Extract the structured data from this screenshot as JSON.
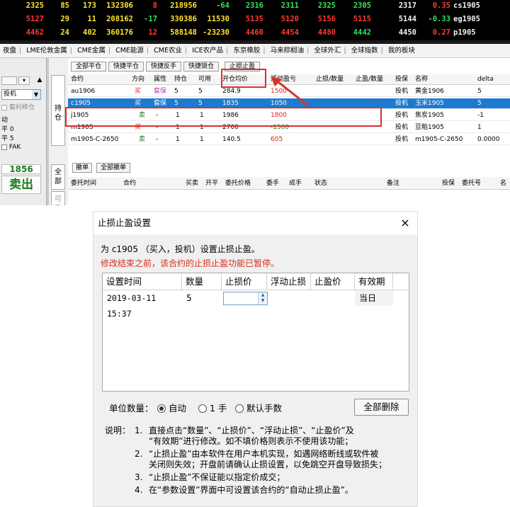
{
  "quote_board": {
    "rows": [
      {
        "c1": "2325",
        "c2": "85",
        "c3": "173",
        "c4": "132306",
        "c5": "8",
        "c6": "218956",
        "c7": "-64",
        "c8": "2316",
        "c9": "2311",
        "c10": "2325",
        "c11": "2305",
        "c12": "2317",
        "c13": "0.35",
        "c14": "cs1905"
      },
      {
        "c1": "5127",
        "c2": "29",
        "c3": "11",
        "c4": "208162",
        "c5": "-17",
        "c6": "330386",
        "c7": "11530",
        "c8": "5135",
        "c9": "5120",
        "c10": "5156",
        "c11": "5115",
        "c12": "5144",
        "c13": "-0.33",
        "c14": "eg1905"
      },
      {
        "c1": "4462",
        "c2": "24",
        "c3": "402",
        "c4": "360176",
        "c5": "12",
        "c6": "588148",
        "c7": "-23230",
        "c8": "4460",
        "c9": "4454",
        "c10": "4480",
        "c11": "4442",
        "c12": "4450",
        "c13": "0.27",
        "c14": "p1905"
      }
    ],
    "colors": {
      "red": "#ff3b30",
      "green": "#33e35a",
      "yellow": "#ffe32e",
      "white": "#f2f2f2",
      "cyan": "#3fd9ff"
    }
  },
  "menu_tabs": [
    "夜盘",
    "LME伦敦金属",
    "CME金属",
    "CME能源",
    "CME农业",
    "ICE农产品",
    "东京橡胶",
    "马来棕榈油",
    "全球外汇",
    "全球指数",
    "我的板块"
  ],
  "left_panel": {
    "select_value": "投机",
    "arbitrage_label": "套利移仓",
    "t1": "动",
    "t2": "平 0",
    "t3": "平 5",
    "fak_label": "FAK",
    "price": "1856",
    "sell_label": "卖出"
  },
  "vertical_tabs": [
    "持仓",
    "全部",
    "可撤"
  ],
  "toolbar": [
    "全部平仓",
    "快捷平仓",
    "快捷反手",
    "快捷锁仓",
    "止损止盈"
  ],
  "positions": {
    "headers": [
      "合约",
      "方向",
      "属性",
      "持仓",
      "可用",
      "开仓均价",
      "浮动盈亏",
      "止损/数量",
      "止盈/数量",
      "投保",
      "名称",
      "delta"
    ],
    "rows": [
      {
        "contract": "au1906",
        "dir": "买",
        "attr": "套保",
        "hold": "5",
        "avail": "5",
        "avg": "284.9",
        "pnl": "1500",
        "stop": "",
        "take": "",
        "hedge": "投机",
        "name": "黄金1906",
        "delta": "5"
      },
      {
        "contract": "c1905",
        "dir": "买",
        "attr": "套保",
        "hold": "5",
        "avail": "5",
        "avg": "1835",
        "pnl": "1050",
        "stop": "",
        "take": "",
        "hedge": "投机",
        "name": "玉米1905",
        "delta": "5"
      },
      {
        "contract": "j1905",
        "dir": "卖",
        "attr": "-",
        "hold": "1",
        "avail": "1",
        "avg": "1986",
        "pnl": "1800",
        "stop": "",
        "take": "",
        "hedge": "投机",
        "name": "焦炭1905",
        "delta": "-1"
      },
      {
        "contract": "m1905",
        "dir": "买",
        "attr": "-",
        "hold": "1",
        "avail": "1",
        "avg": "2700",
        "pnl": "-1500",
        "stop": "",
        "take": "",
        "hedge": "投机",
        "name": "豆粕1905",
        "delta": "1"
      },
      {
        "contract": "m1905-C-2650",
        "dir": "卖",
        "attr": "-",
        "hold": "1",
        "avail": "1",
        "avg": "140.5",
        "pnl": "605",
        "stop": "",
        "take": "",
        "hedge": "投机",
        "name": "m1905-C-2650",
        "delta": "0.0000"
      }
    ],
    "row_colors": {
      "buy": "#d6261c",
      "sell": "#1d7a1d",
      "gain": "#d6261c",
      "loss": "#1d7a1d"
    }
  },
  "order_toolbar": [
    "撤单",
    "全部撤单"
  ],
  "orders_headers": [
    "委托时间",
    "合约",
    "买卖",
    "开平",
    "委托价格",
    "委手",
    "成手",
    "状态",
    "备注",
    "投保",
    "委托号",
    "名"
  ],
  "dialog": {
    "title": "止损止盈设置",
    "close": "×",
    "line1": "为 c1905 （买入，投机）设置止损止盈。",
    "line2": "修改结束之前，该合约的止损止盈功能已暂停。",
    "grid_headers": [
      "设置时间",
      "数量",
      "止损价",
      "浮动止损",
      "止盈价",
      "有效期"
    ],
    "row": {
      "time": "2019-03-11 15:37",
      "qty": "5",
      "stop": "",
      "float": "",
      "take": "",
      "valid": "当日"
    },
    "spin_up": "▲",
    "spin_down": "▼",
    "unit_label": "单位数量：",
    "options": [
      "自动",
      "1 手",
      "默认手数"
    ],
    "clear_all": "全部删除",
    "notes_label": "说明：",
    "notes": [
      {
        "num": "1.",
        "line1": "直接点击“数量”、“止损价”、“浮动止损”、“止盈价”及",
        "line2": "“有效期”进行修改。如不填价格则表示不使用该功能；"
      },
      {
        "num": "2.",
        "line1": "“止损止盈”由本软件在用户本机实现，如遇网络断线或软件被",
        "line2": "关闭则失效；开盘前请确认止损设置，以免跳空开盘导致损失；"
      },
      {
        "num": "3.",
        "line1": "“止损止盈”不保证能以指定价成交；",
        "line2": ""
      },
      {
        "num": "4.",
        "line1": "在“参数设置”界面中可设置该合约的“自动止损止盈”。",
        "line2": ""
      }
    ]
  },
  "highlight_color": "#d8322c"
}
